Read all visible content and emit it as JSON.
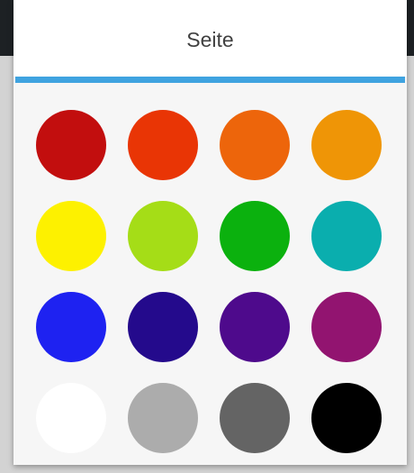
{
  "dialog": {
    "title": "Seite",
    "accent_color": "#3fa3e0"
  },
  "swatches": [
    {
      "name": "dark-red",
      "color": "#c20e0e"
    },
    {
      "name": "red-orange",
      "color": "#e93505"
    },
    {
      "name": "orange",
      "color": "#ed650b"
    },
    {
      "name": "amber",
      "color": "#ef9506"
    },
    {
      "name": "yellow",
      "color": "#fdf100"
    },
    {
      "name": "lime",
      "color": "#a5dd17"
    },
    {
      "name": "green",
      "color": "#0bb10e"
    },
    {
      "name": "teal",
      "color": "#0aaeae"
    },
    {
      "name": "blue",
      "color": "#1e22f1"
    },
    {
      "name": "indigo",
      "color": "#240a8c"
    },
    {
      "name": "purple",
      "color": "#4e0a8c"
    },
    {
      "name": "magenta",
      "color": "#921470"
    },
    {
      "name": "white",
      "color": "#ffffff"
    },
    {
      "name": "light-gray",
      "color": "#acacac"
    },
    {
      "name": "dark-gray",
      "color": "#646464"
    },
    {
      "name": "black",
      "color": "#000000"
    }
  ],
  "backdrop": {
    "appbar_color": "#1d2124",
    "scrim_color": "#d3d3d3"
  }
}
